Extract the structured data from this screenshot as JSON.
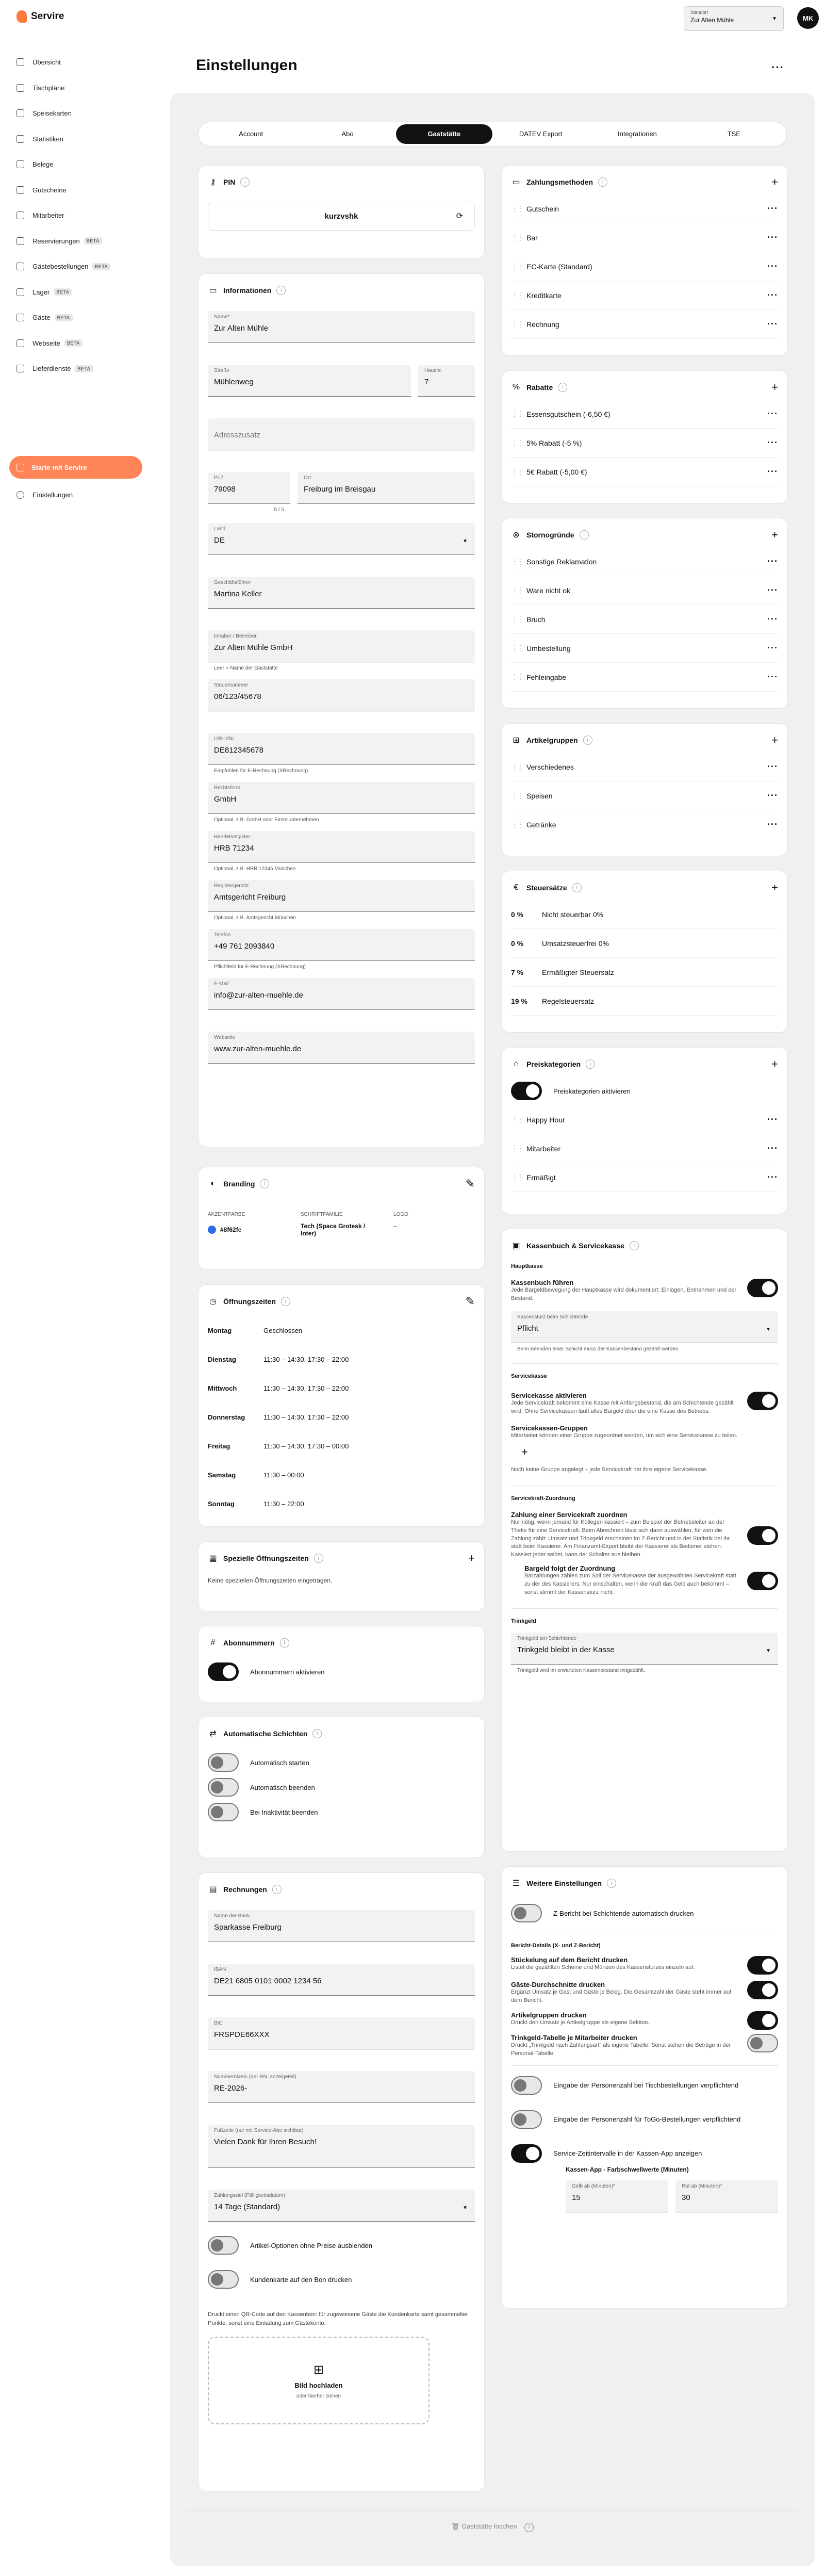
{
  "app": {
    "name": "Servire"
  },
  "sidebar": {
    "items": [
      {
        "label": "Übersicht",
        "beta": ""
      },
      {
        "label": "Tischpläne",
        "beta": ""
      },
      {
        "label": "Speisekarten",
        "beta": ""
      },
      {
        "label": "Statistiken",
        "beta": ""
      },
      {
        "label": "Belege",
        "beta": ""
      },
      {
        "label": "Gutscheine",
        "beta": ""
      },
      {
        "label": "Mitarbeiter",
        "beta": ""
      },
      {
        "label": "Reservierungen",
        "beta": "BETA"
      },
      {
        "label": "Gästebestellungen",
        "beta": "BETA"
      },
      {
        "label": "Lager",
        "beta": "BETA"
      },
      {
        "label": "Gäste",
        "beta": "BETA"
      },
      {
        "label": "Webseite",
        "beta": "BETA"
      },
      {
        "label": "Lieferdienste",
        "beta": "BETA"
      }
    ],
    "cta": "Starte mit Servire",
    "settings": "Einstellungen"
  },
  "header": {
    "location_label": "Standort",
    "location_value": "Zur Alten Mühle",
    "avatar": "MK",
    "title": "Einstellungen"
  },
  "tabs": [
    "Account",
    "Abo",
    "Gaststätte",
    "DATEV Export",
    "Integrationen",
    "TSE"
  ],
  "pin": {
    "title": "PIN",
    "value": "kurzvshk"
  },
  "info": {
    "title": "Informationen",
    "name_l": "Name*",
    "name_v": "Zur Alten Mühle",
    "street_l": "Straße",
    "street_v": "Mühlenweg",
    "hn_l": "Hausnr.",
    "hn_v": "7",
    "addr2_l": "Adresszusatz",
    "plz_l": "PLZ",
    "plz_v": "79098",
    "city_l": "Ort",
    "city_v": "Freiburg im Breisgau",
    "plz_count": "5 / 5",
    "land_l": "Land",
    "land_v": "DE",
    "gf_l": "Geschäftsführer",
    "gf_v": "Martina Keller",
    "owner_l": "Inhaber / Betreiber",
    "owner_v": "Zur Alten Mühle GmbH",
    "owner_h": "Leer = Name der Gaststätte",
    "tax_l": "Steuernummer",
    "tax_v": "06/123/45678",
    "ust_l": "USt-IdNr.",
    "ust_v": "DE812345678",
    "ust_h": "Empfohlen für E-Rechnung (XRechnung)",
    "rf_l": "Rechtsform",
    "rf_v": "GmbH",
    "rf_h": "Optional, z.B. GmbH oder Einzelunternehmen",
    "hr_l": "Handelsregister",
    "hr_v": "HRB 71234",
    "hr_h": "Optional, z.B. HRB 12345 München",
    "rg_l": "Registergericht",
    "rg_v": "Amtsgericht Freiburg",
    "rg_h": "Optional, z.B. Amtsgericht München",
    "tel_l": "Telefon",
    "tel_v": "+49 761 2093840",
    "tel_h": "Pflichtfeld für E-Rechnung (XRechnung)",
    "mail_l": "E-Mail",
    "mail_v": "info@zur-alten-muehle.de",
    "web_l": "Webseite",
    "web_v": "www.zur-alten-muehle.de"
  },
  "branding": {
    "title": "Branding",
    "accent_l": "AKZENTFARBE",
    "accent_v": "#8f62fe",
    "accent_color": "#2b6ee6",
    "font_l": "SCHRIFTFAMILIE",
    "font_v": "Tech (Space Grotesk / Inter)",
    "logo_l": "LOGO",
    "logo_v": "–"
  },
  "hours": {
    "title": "Öffnungszeiten",
    "rows": [
      {
        "d": "Montag",
        "t": "Geschlossen"
      },
      {
        "d": "Dienstag",
        "t": "11:30 – 14:30, 17:30 – 22:00"
      },
      {
        "d": "Mittwoch",
        "t": "11:30 – 14:30, 17:30 – 22:00"
      },
      {
        "d": "Donnerstag",
        "t": "11:30 – 14:30, 17:30 – 22:00"
      },
      {
        "d": "Freitag",
        "t": "11:30 – 14:30, 17:30 – 00:00"
      },
      {
        "d": "Samstag",
        "t": "11:30 – 00:00"
      },
      {
        "d": "Sonntag",
        "t": "11:30 – 22:00"
      }
    ]
  },
  "special": {
    "title": "Spezielle Öffnungszeiten",
    "empty": "Keine speziellen Öffnungszeiten eingetragen."
  },
  "abo": {
    "title": "Abonnummern",
    "toggle": "Abonnummern aktivieren"
  },
  "shifts": {
    "title": "Automatische Schichten",
    "t1": "Automatisch starten",
    "t2": "Automatisch beenden",
    "t3": "Bei Inaktivität beenden"
  },
  "invoices": {
    "title": "Rechnungen",
    "bank_l": "Name der Bank",
    "bank_v": "Sparkasse Freiburg",
    "iban_l": "IBAN",
    "iban_v": "DE21 6805 0101 0002 1234 56",
    "bic_l": "BIC",
    "bic_v": "FRSPDE66XXX",
    "prefix_l": "Nummernkreis (der RN. anzeigeteil)",
    "prefix_v": "RE-2026-",
    "footer_l": "Fußzeile (nur mit Service-Abo sichtbar)",
    "footer_v": "Vielen Dank für Ihren Besuch!",
    "pay_l": "Zahlungsziel (Fälligkeitsdatum)",
    "pay_v": "14 Tage (Standard)",
    "t1": "Artikel-Optionen ohne Preise ausblenden",
    "t2": "Kundenkarte auf den Bon drucken",
    "note": "Druckt einen QR-Code auf den Kassenbon: für zugewiesene Gäste die Kundenkarte samt gesammelter Punkte, sonst eine Einladung zum Gästekonto.",
    "upload": "Bild hochladen",
    "upload_sub": "oder hierher ziehen"
  },
  "payments": {
    "title": "Zahlungsmethoden",
    "items": [
      "Gutschein",
      "Bar",
      "EC-Karte (Standard)",
      "Kreditkarte",
      "Rechnung"
    ]
  },
  "discounts": {
    "title": "Rabatte",
    "items": [
      "Essensgutschein (-6,50 €)",
      "5% Rabatt (-5 %)",
      "5€ Rabatt (-5,00 €)"
    ]
  },
  "storno": {
    "title": "Stornogründe",
    "items": [
      "Sonstige Reklamation",
      "Ware nicht ok",
      "Bruch",
      "Umbestellung",
      "Fehleingabe"
    ]
  },
  "groups": {
    "title": "Artikelgruppen",
    "items": [
      "Verschiedenes",
      "Speisen",
      "Getränke"
    ]
  },
  "taxes": {
    "title": "Steuersätze",
    "items": [
      {
        "p": "0 %",
        "n": "Nicht steuerbar 0%"
      },
      {
        "p": "0 %",
        "n": "Umsatzsteuerfrei 0%"
      },
      {
        "p": "7 %",
        "n": "Ermäßigter Steuersatz"
      },
      {
        "p": "19 %",
        "n": "Regelsteuersatz"
      }
    ]
  },
  "pricecats": {
    "title": "Preiskategorien",
    "toggle": "Preiskategorien aktivieren",
    "items": [
      "Happy Hour",
      "Mitarbeiter",
      "Ermäßigt"
    ]
  },
  "cashbook": {
    "title": "Kassenbuch & Servicekasse",
    "h1": "Hauptkasse",
    "cb_t": "Kassenbuch führen",
    "cb_d": "Jede Bargeldbewegung der Hauptkasse wird dokumentiert: Einlagen, Entnahmen und der Bestand.",
    "cnt_l": "Kassensturz beim Schichtende",
    "cnt_v": "Pflicht",
    "cnt_h": "Beim Beenden einer Schicht muss der Kassenbestand gezählt werden.",
    "h2": "Servicekasse",
    "sk_t": "Servicekasse aktivieren",
    "sk_d": "Jede Servicekraft bekommt eine Kasse mit Anfangsbestand, die am Schichtende gezählt wird. Ohne Servicekassen läuft alles Bargeld über die eine Kasse des Betriebs.",
    "grp_t": "Servicekassen-Gruppen",
    "grp_d": "Mitarbeiter können einer Gruppe zugeordnet werden, um sich eine Servicekasse zu teilen.",
    "grp_none": "Noch keine Gruppe angelegt – jede Servicekraft hat ihre eigene Servicekasse.",
    "h3": "Servicekraft-Zuordnung",
    "za_t": "Zahlung einer Servicekraft zuordnen",
    "za_d": "Nur nötig, wenn jemand für Kollegen kassiert – zum Beispiel der Betriebsleiter an der Theke für eine Servicekraft. Beim Abrechnen lässt sich dann auswählen, für wen die Zahlung zählt: Umsatz und Trinkgeld erscheinen im Z-Bericht und in der Statistik bei ihr statt beim Kassierer. Am Finanzamt-Export bleibt der Kassierer als Bediener stehen. Kassiert jeder selbst, kann der Schalter aus bleiben.",
    "bf_t": "Bargeld folgt der Zuordnung",
    "bf_d": "Barzahlungen zählen zum Soll der Servicekasse der ausgewählten Servicekraft statt zu der des Kassierers. Nur einschalten, wenn die Kraft das Geld auch bekommt – sonst stimmt der Kassensturz nicht.",
    "h4": "Trinkgeld",
    "tip_l": "Trinkgeld am Schichtende",
    "tip_v": "Trinkgeld bleibt in der Kasse",
    "tip_h": "Trinkgeld wird im erwarteten Kassenbestand mitgezählt."
  },
  "more": {
    "title": "Weitere Einstellungen",
    "z": "Z-Bericht bei Schichtende automatisch drucken",
    "h": "Bericht-Details (X- und Z-Bericht)",
    "s1_t": "Stückelung auf dem Bericht drucken",
    "s1_d": "Listet die gezählten Scheine und Münzen des Kassensturzes einzeln auf.",
    "s2_t": "Gäste-Durchschnitte drucken",
    "s2_d": "Ergänzt Umsatz je Gast und Gäste je Beleg. Die Gesamtzahl der Gäste steht immer auf dem Bericht.",
    "s3_t": "Artikelgruppen drucken",
    "s3_d": "Druckt den Umsatz je Artikelgruppe als eigene Sektion.",
    "s4_t": "Trinkgeld-Tabelle je Mitarbeiter drucken",
    "s4_d": "Druckt „Trinkgeld nach Zahlungsart“ als eigene Tabelle. Sonst stehen die Beträge in der Personal-Tabelle.",
    "p1": "Eingabe der Personenzahl bei Tischbestellungen verpflichtend",
    "p2": "Eingabe der Personenzahl für ToGo-Bestellungen verpflichtend",
    "p3": "Service-Zeitintervalle in der Kassen-App anzeigen",
    "col_t": "Kassen-App - Farbschwellwerte (Minuten)",
    "y_l": "Gelb ab (Minuten)*",
    "y_v": "15",
    "r_l": "Rot ab (Minuten)*",
    "r_v": "30"
  },
  "footer": {
    "delete": "Gaststätte löschen"
  }
}
